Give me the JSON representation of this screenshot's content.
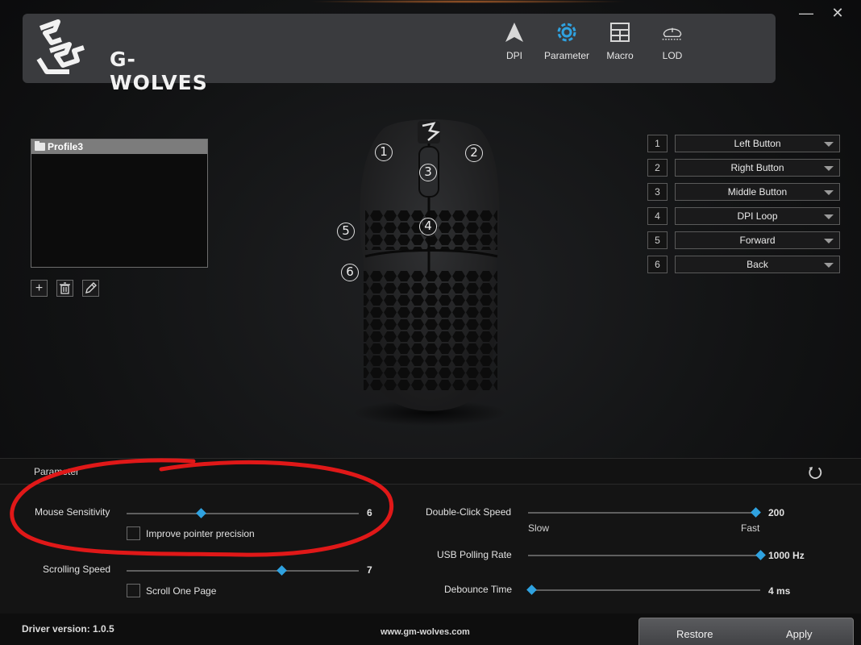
{
  "app": {
    "brand": "G-WOLVES"
  },
  "window_controls": {
    "minimize": "—",
    "close": "✕"
  },
  "nav": [
    {
      "label": "DPI",
      "icon": "dpi-arrow-icon",
      "active": false
    },
    {
      "label": "Parameter",
      "icon": "gear-icon",
      "active": true
    },
    {
      "label": "Macro",
      "icon": "macro-grid-icon",
      "active": false
    },
    {
      "label": "LOD",
      "icon": "lod-mouse-icon",
      "active": false
    }
  ],
  "profiles": {
    "items": [
      "Profile3"
    ],
    "selected": "Profile3"
  },
  "profile_buttons": {
    "add": "+",
    "delete": "delete",
    "edit": "edit"
  },
  "callouts": [
    "1",
    "2",
    "3",
    "4",
    "5",
    "6"
  ],
  "button_map": [
    {
      "num": "1",
      "value": "Left Button"
    },
    {
      "num": "2",
      "value": "Right Button"
    },
    {
      "num": "3",
      "value": "Middle Button"
    },
    {
      "num": "4",
      "value": "DPI Loop"
    },
    {
      "num": "5",
      "value": "Forward"
    },
    {
      "num": "6",
      "value": "Back"
    }
  ],
  "parameter": {
    "title": "Parameter",
    "mouse_sensitivity": {
      "label": "Mouse Sensitivity",
      "value": "6",
      "level": 0.32
    },
    "pointer_precision": {
      "label": "Improve pointer precision",
      "checked": false
    },
    "scrolling_speed": {
      "label": "Scrolling Speed",
      "value": "7",
      "level": 0.67
    },
    "scroll_one_page": {
      "label": "Scroll One Page",
      "checked": false
    },
    "double_click": {
      "label": "Double-Click Speed",
      "value": "200",
      "level": 0.98,
      "slow": "Slow",
      "fast": "Fast"
    },
    "polling_rate": {
      "label": "USB Polling Rate",
      "value": "1000 Hz",
      "level": 1.0
    },
    "debounce": {
      "label": "Debounce Time",
      "value": "4 ms",
      "level": 0.0
    }
  },
  "footer": {
    "driver": "Driver version: 1.0.5",
    "site": "www.gm-wolves.com",
    "restore": "Restore",
    "apply": "Apply"
  },
  "colors": {
    "accent": "#2fa2e0",
    "header": "#3a3b3e",
    "annotation": "#e01818"
  }
}
